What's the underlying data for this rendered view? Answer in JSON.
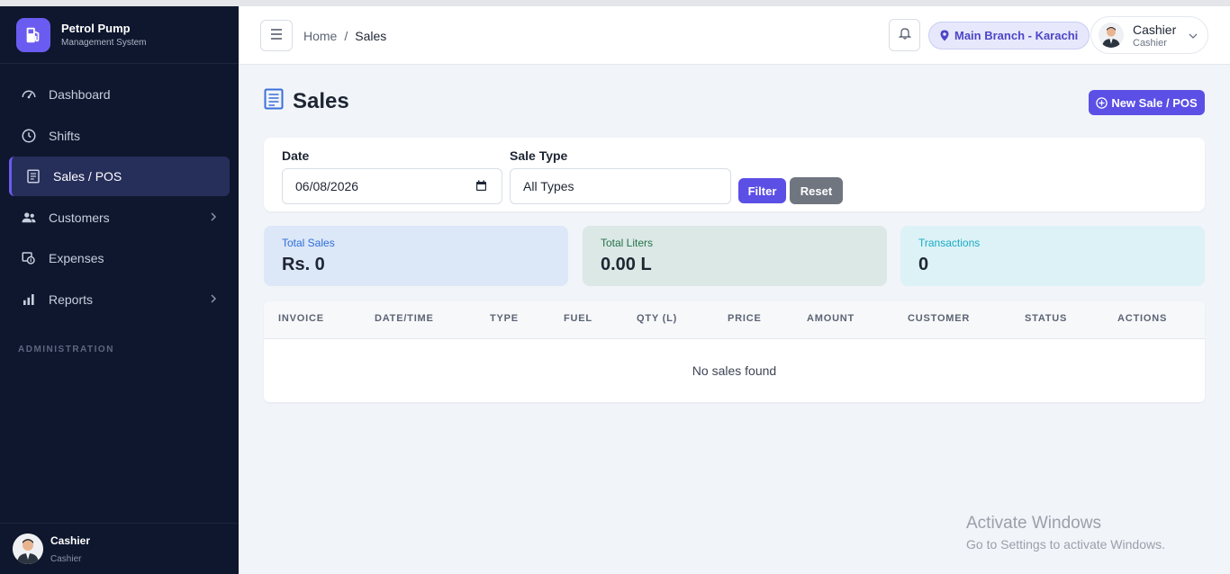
{
  "brand": {
    "title": "Petrol Pump",
    "subtitle": "Management System"
  },
  "sidebar": {
    "items": [
      {
        "label": "Dashboard",
        "icon": "gauge-icon",
        "active": false,
        "has_children": false
      },
      {
        "label": "Shifts",
        "icon": "clock-icon",
        "active": false,
        "has_children": false
      },
      {
        "label": "Sales / POS",
        "icon": "receipt-icon",
        "active": true,
        "has_children": false
      },
      {
        "label": "Customers",
        "icon": "users-icon",
        "active": false,
        "has_children": true
      },
      {
        "label": "Expenses",
        "icon": "money-icon",
        "active": false,
        "has_children": false
      },
      {
        "label": "Reports",
        "icon": "bar-chart-icon",
        "active": false,
        "has_children": true
      }
    ],
    "section_label": "ADMINISTRATION",
    "user": {
      "name": "Cashier",
      "role": "Cashier"
    }
  },
  "header": {
    "breadcrumb": {
      "home": "Home",
      "separator": "/",
      "current": "Sales"
    },
    "branch": "Main Branch - Karachi",
    "user": {
      "name": "Cashier",
      "role": "Cashier"
    }
  },
  "page": {
    "title": "Sales",
    "new_sale_label": "New Sale / POS"
  },
  "filters": {
    "date_label": "Date",
    "date_value": "06/08/2026",
    "sale_type_label": "Sale Type",
    "sale_type_value": "All Types",
    "filter_label": "Filter",
    "reset_label": "Reset"
  },
  "stats": [
    {
      "label": "Total Sales",
      "value": "Rs. 0",
      "color": "#2f6fd8",
      "bg": "#dce7f8"
    },
    {
      "label": "Total Liters",
      "value": "0.00 L",
      "color": "#23734a",
      "bg": "#dce8e6"
    },
    {
      "label": "Transactions",
      "value": "0",
      "color": "#1aaac6",
      "bg": "#dcf2f6"
    }
  ],
  "table": {
    "columns": [
      "INVOICE",
      "DATE/TIME",
      "TYPE",
      "FUEL",
      "QTY (L)",
      "PRICE",
      "AMOUNT",
      "CUSTOMER",
      "STATUS",
      "ACTIONS"
    ],
    "empty_text": "No sales found"
  },
  "watermark": {
    "line1": "Activate Windows",
    "line2": "Go to Settings to activate Windows."
  },
  "colors": {
    "accent": "#5b4fe6",
    "sidebar_bg": "#0f172e",
    "page_bg": "#f1f4f9"
  }
}
